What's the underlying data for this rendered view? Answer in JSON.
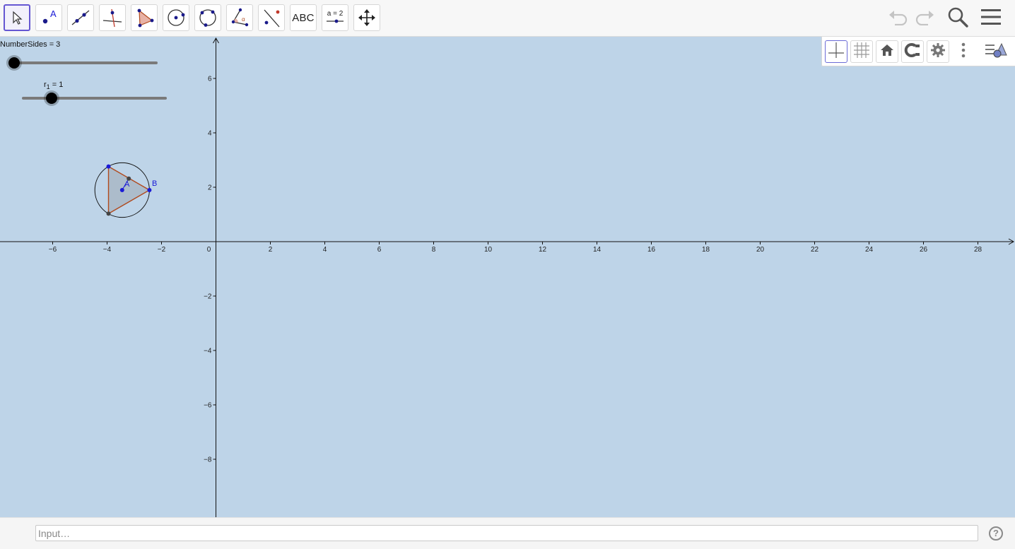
{
  "toolbar": {
    "tools": [
      {
        "name": "move-tool",
        "icon": "arrow-pointer-icon",
        "selected": true
      },
      {
        "name": "point-tool",
        "icon": "point-icon",
        "label": "A"
      },
      {
        "name": "line-tool",
        "icon": "line-through-points-icon"
      },
      {
        "name": "perpendicular-line-tool",
        "icon": "perpendicular-icon"
      },
      {
        "name": "polygon-tool",
        "icon": "polygon-icon"
      },
      {
        "name": "circle-tool",
        "icon": "circle-center-point-icon"
      },
      {
        "name": "circle-three-points-tool",
        "icon": "circle-three-points-icon"
      },
      {
        "name": "angle-tool",
        "icon": "angle-icon"
      },
      {
        "name": "reflect-tool",
        "icon": "reflect-about-line-icon"
      },
      {
        "name": "text-tool",
        "icon": "text-icon",
        "label": "ABC"
      },
      {
        "name": "slider-tool",
        "icon": "slider-icon",
        "label": "a = 2"
      },
      {
        "name": "move-graphics-view-tool",
        "icon": "move-arrows-icon"
      }
    ],
    "right": [
      "undo-icon",
      "redo-icon",
      "search-icon",
      "menu-icon"
    ]
  },
  "style_bar": {
    "buttons": [
      "axes-icon",
      "grid-icon",
      "home-icon",
      "point-capturing-icon",
      "gear-icon",
      "more-vertical-icon"
    ],
    "toggle": "style-bar-toggle-icon"
  },
  "sliders": [
    {
      "label": "NumberSides = 3",
      "value": 3
    },
    {
      "label_base": "r",
      "label_sub": "1",
      "label_rest": " = 1",
      "value": 1
    }
  ],
  "graph": {
    "x_ticks": [
      "−6",
      "−4",
      "−2",
      "0",
      "2",
      "4",
      "6",
      "8",
      "10",
      "12",
      "14",
      "16",
      "18",
      "20",
      "22",
      "24",
      "26",
      "28"
    ],
    "y_ticks": [
      "6",
      "4",
      "2",
      "−2",
      "−4",
      "−6",
      "−8"
    ],
    "points": [
      {
        "label": "A",
        "x": -3.5,
        "y": 1.9
      },
      {
        "label": "B",
        "x": -2.5,
        "y": 1.9
      }
    ]
  },
  "input_bar": {
    "placeholder": "Input…",
    "help": "?"
  },
  "colors": {
    "canvas": "#bed4e8",
    "accent": "#6557d2",
    "point": "#1a1ad6",
    "polygon_edge": "#b04a1e"
  }
}
